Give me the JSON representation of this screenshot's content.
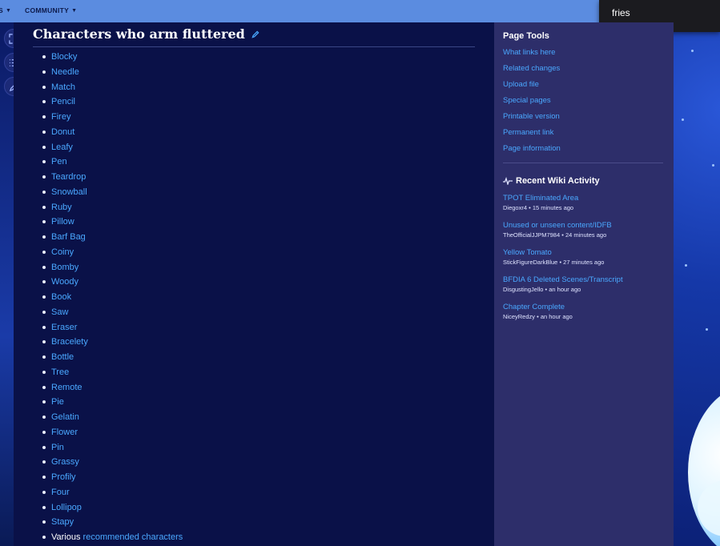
{
  "nav": {
    "items": [
      {
        "label": "S"
      },
      {
        "label": "COMMUNITY"
      }
    ]
  },
  "search": {
    "value": "fries"
  },
  "page": {
    "title": "Characters who arm fluttered",
    "characters": [
      "Blocky",
      "Needle",
      "Match",
      "Pencil",
      "Firey",
      "Donut",
      "Leafy",
      "Pen",
      "Teardrop",
      "Snowball",
      "Ruby",
      "Pillow",
      "Barf Bag",
      "Coiny",
      "Bomby",
      "Woody",
      "Book",
      "Saw",
      "Eraser",
      "Bracelety",
      "Bottle",
      "Tree",
      "Remote",
      "Pie",
      "Gelatin",
      "Flower",
      "Pin",
      "Grassy",
      "Profily",
      "Four",
      "Lollipop",
      "Stapy"
    ],
    "last_item": {
      "prefix": "Various",
      "link": "recommended characters"
    }
  },
  "sidebar": {
    "page_tools_heading": "Page Tools",
    "tools": [
      "What links here",
      "Related changes",
      "Upload file",
      "Special pages",
      "Printable version",
      "Permanent link",
      "Page information"
    ],
    "activity_heading": "Recent Wiki Activity",
    "activity": [
      {
        "title": "TPOT Eliminated Area",
        "user": "Diegoxr4",
        "time": "15 minutes ago"
      },
      {
        "title": "Unused or unseen content/IDFB",
        "user": "TheOfficialJJPM7984",
        "time": "24 minutes ago"
      },
      {
        "title": "Yellow Tomato",
        "user": "StickFigureDarkBlue",
        "time": "27 minutes ago"
      },
      {
        "title": "BFDIA 6 Deleted Scenes/Transcript",
        "user": "DisgustingJello",
        "time": "an hour ago"
      },
      {
        "title": "Chapter Complete",
        "user": "NiceyRedzy",
        "time": "an hour ago"
      }
    ]
  },
  "colors": {
    "nav": "#5b8ce0",
    "link": "#4aa8ff",
    "sidebar": "#2d2e6a",
    "content": "#0a1148"
  }
}
